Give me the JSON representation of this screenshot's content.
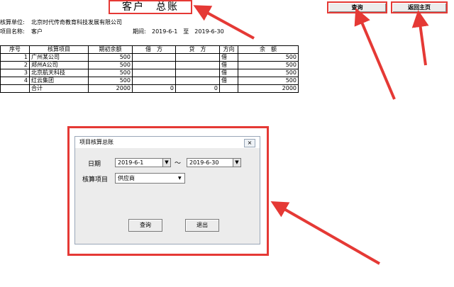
{
  "header": {
    "title": "客户　总账",
    "unit_label": "核算单位:",
    "unit_value": "北京时代传奇教育科技发展有限公司",
    "project_label": "项目名称:",
    "project_value": "客户",
    "period_label": "期间:",
    "period_value": "2019-6-1　至　2019-6-30"
  },
  "top_buttons": {
    "query": "查询",
    "home": "返回主页"
  },
  "ledger": {
    "columns": [
      "序号",
      "核算项目",
      "期初余额",
      "借　方",
      "贷　方",
      "方向",
      "余　额"
    ],
    "rows": [
      [
        "1",
        "广州某公司",
        "500",
        "",
        "",
        "借",
        "500"
      ],
      [
        "2",
        "郑州A公司",
        "500",
        "",
        "",
        "借",
        "500"
      ],
      [
        "3",
        "北京航天科技",
        "500",
        "",
        "",
        "借",
        "500"
      ],
      [
        "4",
        "红云集团",
        "500",
        "",
        "",
        "借",
        "500"
      ]
    ],
    "total": [
      "",
      "合计",
      "2000",
      "0",
      "0",
      "",
      "2000"
    ]
  },
  "dialog": {
    "title": "项目核算总账",
    "close": "×",
    "date_label": "日期",
    "date_from": "2019-6-1",
    "tilde": "～",
    "date_to": "2019-6-30",
    "item_label": "核算项目",
    "item_value": "供应商",
    "dropdown_glyph": "▼",
    "query_btn": "查询",
    "exit_btn": "退出"
  },
  "colors": {
    "highlight": "#e53935"
  }
}
